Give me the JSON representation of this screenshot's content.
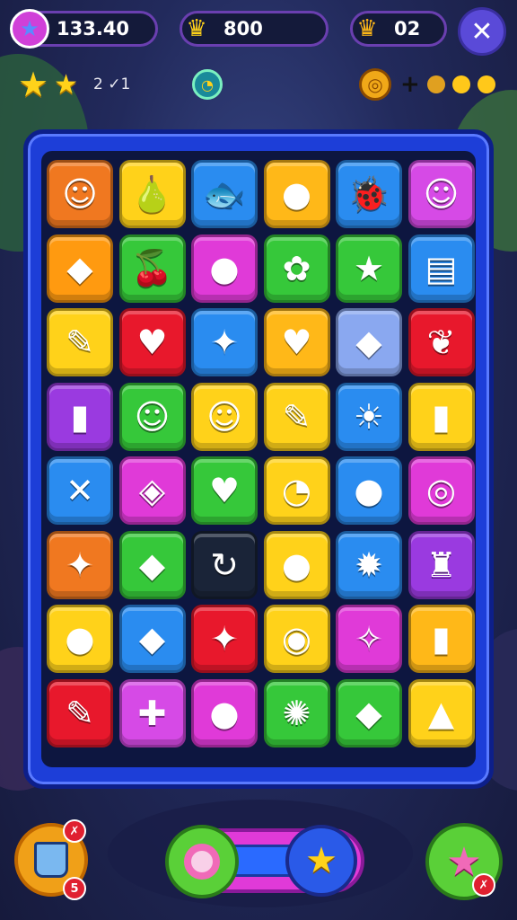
{
  "hud": {
    "coins_value": "133.40",
    "stars_value": "800",
    "crowns_value": "02",
    "coins_icon": "gem-icon",
    "stars_icon": "star-icon",
    "crowns_icon": "crown-icon",
    "close_icon": "close-icon"
  },
  "level": {
    "moves_text": "2 ✓1",
    "stars_earned": 2,
    "timer_icon": "clock-icon"
  },
  "progress": {
    "swirl_icon": "swirl-candy-icon",
    "plus_symbol": "+",
    "dots_filled": 3
  },
  "board": {
    "rows": 8,
    "cols": 6,
    "tiles": [
      [
        "#f07820",
        "☺"
      ],
      [
        "#ffd21a",
        "🍐"
      ],
      [
        "#2a8cf0",
        "🐟"
      ],
      [
        "#ffb818",
        "●"
      ],
      [
        "#2a8cf0",
        "🐞"
      ],
      [
        "#d64ae6",
        "☺"
      ],
      [
        "#ff9a10",
        "◆"
      ],
      [
        "#36c83a",
        "🍒"
      ],
      [
        "#e03ad8",
        "●"
      ],
      [
        "#36c83a",
        "✿"
      ],
      [
        "#36c83a",
        "★"
      ],
      [
        "#2a8cf0",
        "▤"
      ],
      [
        "#ffd21a",
        "✎"
      ],
      [
        "#e8182c",
        "♥"
      ],
      [
        "#2a8cf0",
        "✦"
      ],
      [
        "#ffb818",
        "♥"
      ],
      [
        "#8aa8f0",
        "◆"
      ],
      [
        "#e8182c",
        "❦"
      ],
      [
        "#9a3ae0",
        "▮"
      ],
      [
        "#36c83a",
        "☺"
      ],
      [
        "#ffd21a",
        "☺"
      ],
      [
        "#ffd21a",
        "✎"
      ],
      [
        "#2a8cf0",
        "☀"
      ],
      [
        "#ffd21a",
        "▮"
      ],
      [
        "#2a8cf0",
        "✕"
      ],
      [
        "#e03ad8",
        "◈"
      ],
      [
        "#36c83a",
        "♥"
      ],
      [
        "#ffd21a",
        "◔"
      ],
      [
        "#2a8cf0",
        "●"
      ],
      [
        "#e03ad8",
        "◎"
      ],
      [
        "#f07820",
        "✦"
      ],
      [
        "#36c83a",
        "◆"
      ],
      [
        "#1a2438",
        "↻"
      ],
      [
        "#ffd21a",
        "●"
      ],
      [
        "#2a8cf0",
        "✹"
      ],
      [
        "#9a3ae0",
        "♜"
      ],
      [
        "#ffd21a",
        "●"
      ],
      [
        "#2a8cf0",
        "◆"
      ],
      [
        "#e8182c",
        "✦"
      ],
      [
        "#ffd21a",
        "◉"
      ],
      [
        "#e03ad8",
        "✧"
      ],
      [
        "#ffb818",
        "▮"
      ],
      [
        "#e8182c",
        "✎"
      ],
      [
        "#d64ae6",
        "✚"
      ],
      [
        "#e03ad8",
        "●"
      ],
      [
        "#36c83a",
        "✺"
      ],
      [
        "#36c83a",
        "◆"
      ],
      [
        "#ffd21a",
        "▲"
      ]
    ]
  },
  "bottom": {
    "left_button_icon": "bucket-icon",
    "left_badge_top": "✗",
    "left_badge_bottom": "5",
    "center_left_icon": "candy-icon",
    "center_right_icon": "star-icon",
    "right_button_icon": "star-icon",
    "right_badge": "✗"
  },
  "colors": {
    "frame_blue": "#1d3ed8",
    "gold": "#ffd21a",
    "purple_border": "#6a3fb0"
  }
}
